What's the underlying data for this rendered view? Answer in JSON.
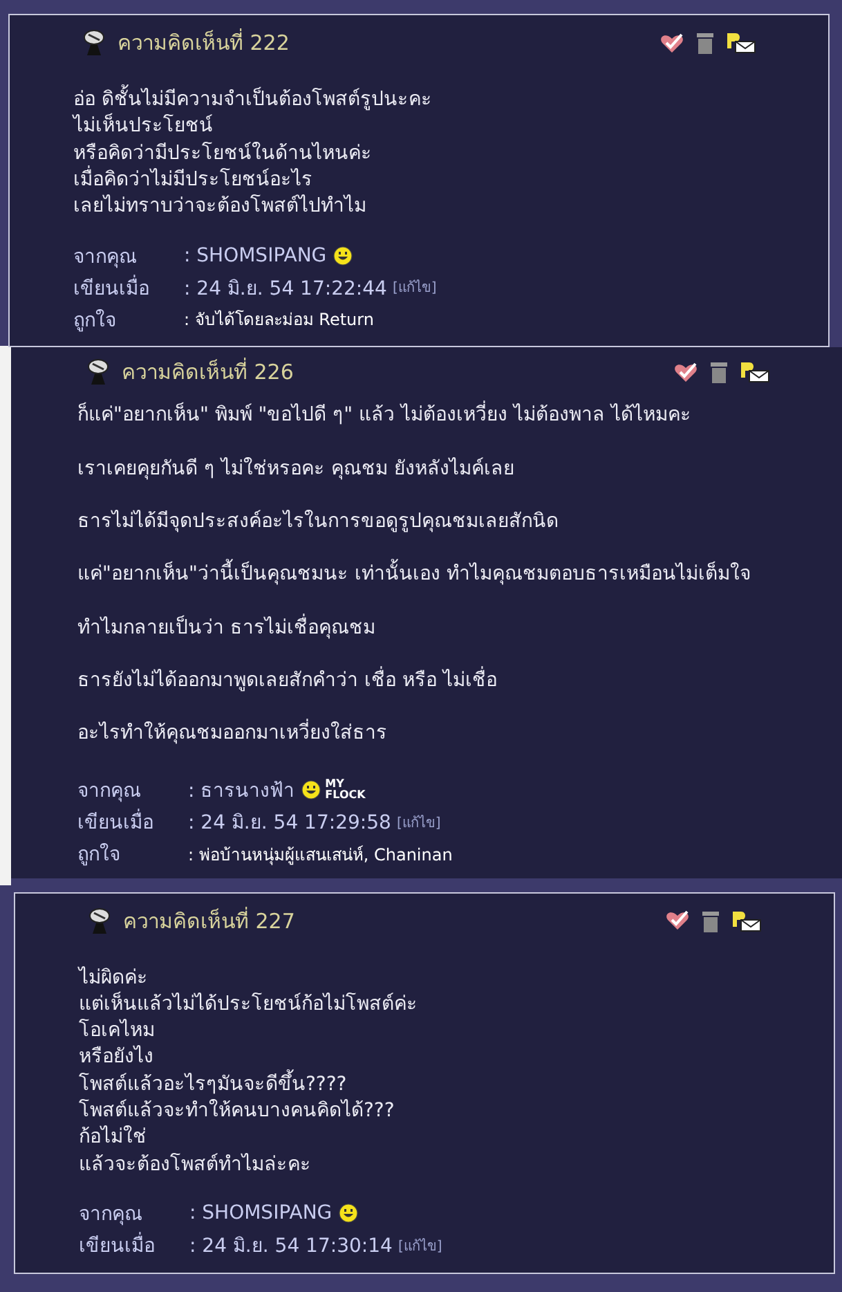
{
  "comments": [
    {
      "title": "ความคิดเห็นที่ 222",
      "kind": "lines",
      "body": [
        "อ่อ ดิชั้นไม่มีความจำเป็นต้องโพสต์รูปนะคะ",
        "ไม่เห็นประโยชน์",
        "หรือคิดว่ามีประโยชน์ในด้านไหนค่ะ",
        "เมื่อคิดว่าไม่มีประโยชน์อะไร",
        "เลยไม่ทราบว่าจะต้องโพสต์ไปทำไม"
      ],
      "meta": [
        {
          "label": "จากคุณ",
          "value": ": SHOMSIPANG",
          "smiley": true
        },
        {
          "label": "เขียนเมื่อ",
          "value": ": 24 มิ.ย. 54 17:22:44",
          "link": "[แก้ไข]"
        },
        {
          "label": "ถูกใจ",
          "value": ": จับได้โดยละม่อม Return",
          "small": true
        }
      ]
    },
    {
      "title": "ความคิดเห็นที่ 226",
      "kind": "paragraphs",
      "body": [
        "ก็แค่\"อยากเห็น\" พิมพ์ \"ขอไปดี ๆ\" แล้ว ไม่ต้องเหวี่ยง ไม่ต้องพาล ได้ไหมคะ",
        "เราเคยคุยกันดี ๆ ไม่ใช่หรอคะ คุณชม ยังหลังไมค์เลย",
        "ธารไม่ได้มีจุดประสงค์อะไรในการขอดูรูปคุณชมเลยสักนิด",
        "แค่\"อยากเห็น\"ว่านี้เป็นคุณชมนะ เท่านั้นเอง ทำไมคุณชมตอบธารเหมือนไม่เต็มใจ",
        "ทำไมกลายเป็นว่า ธารไม่เชื่อคุณชม",
        "ธารยังไม่ได้ออกมาพูดเลยสักคำว่า เชื่อ หรือ ไม่เชื่อ",
        "อะไรทำให้คุณชมออกมาเหวี่ยงใส่ธาร"
      ],
      "meta": [
        {
          "label": "จากคุณ",
          "value": ": ธารนางฟ้า",
          "smiley": true,
          "badge": "MY FLOCK"
        },
        {
          "label": "เขียนเมื่อ",
          "value": ": 24 มิ.ย. 54 17:29:58",
          "link": "[แก้ไข]"
        },
        {
          "label": "ถูกใจ",
          "value": ": พ่อบ้านหนุ่มผู้แสนเสน่ห์, Chaninan",
          "small": true
        }
      ]
    },
    {
      "title": "ความคิดเห็นที่ 227",
      "kind": "lines",
      "body": [
        "ไม่ผิดค่ะ",
        "แต่เห็นแล้วไม่ได้ประโยชน์ก้อไม่โพสต์ค่ะ",
        "โอเคไหม",
        "หรือยังไง",
        "โพสต์แล้วอะไรๆมันจะดีขึ้น????",
        "โพสต์แล้วจะทำให้คนบางคนคิดได้???",
        "ก้อไม่ใช่",
        "แล้วจะต้องโพสต์ทำไมล่ะคะ"
      ],
      "meta": [
        {
          "label": "จากคุณ",
          "value": ": SHOMSIPANG",
          "smiley": true
        },
        {
          "label": "เขียนเมื่อ",
          "value": ": 24 มิ.ย. 54 17:30:14",
          "link": "[แก้ไข]"
        }
      ]
    }
  ]
}
